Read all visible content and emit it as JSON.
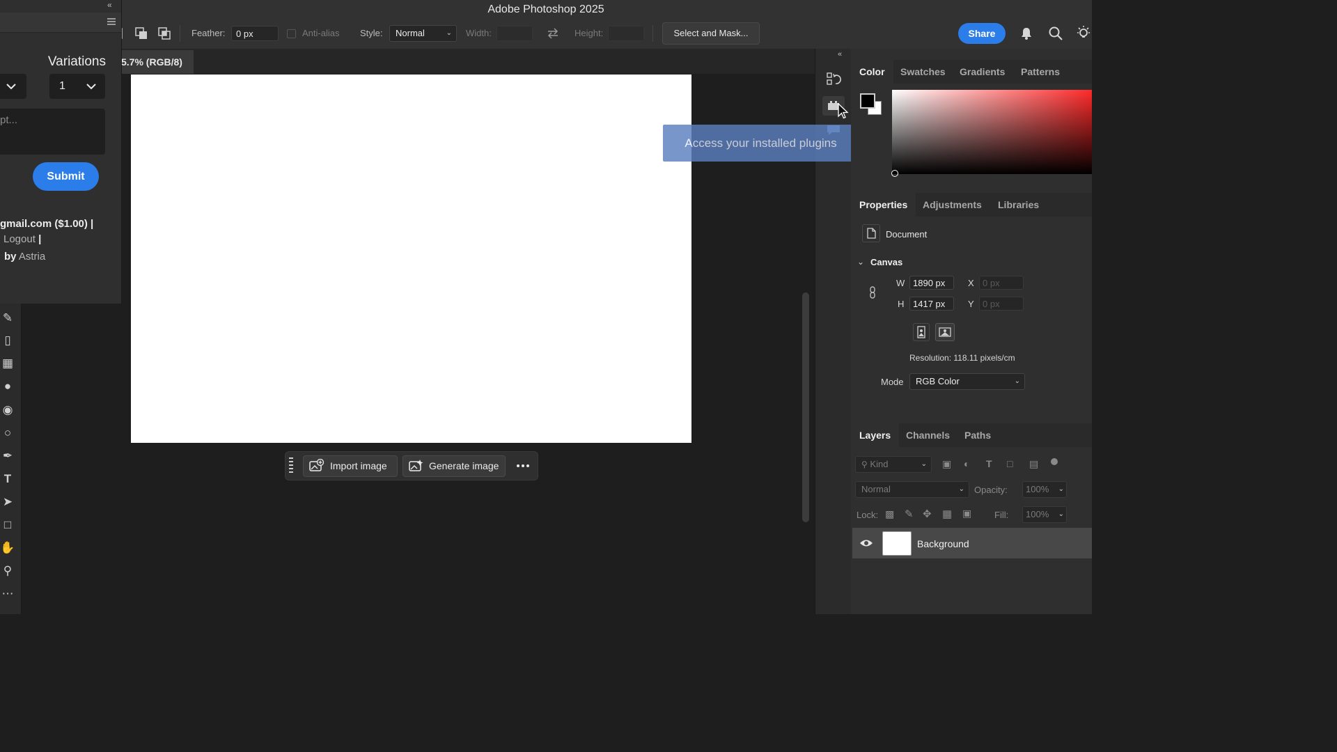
{
  "app": {
    "title": "Adobe Photoshop 2025"
  },
  "options_bar": {
    "feather_label": "Feather:",
    "feather_value": "0 px",
    "antialias_label": "Anti-alias",
    "style_label": "Style:",
    "style_value": "Normal",
    "width_label": "Width:",
    "height_label": "Height:",
    "select_mask_label": "Select and Mask...",
    "share_label": "Share"
  },
  "plugin_panel": {
    "variations_label": "Variations",
    "variations_value": "1",
    "prompt_placeholder": "pt...",
    "submit_label": "Submit",
    "account_text": "gmail.com ($1.00) |",
    "logout_label": "Logout",
    "logout_sep": "|",
    "by_label": "by",
    "by_link": "Astria"
  },
  "document": {
    "tab_label": "5.7% (RGB/8)"
  },
  "contextual_taskbar": {
    "import_label": "Import image",
    "generate_label": "Generate image"
  },
  "tooltip": {
    "text": "Access your installed plugins"
  },
  "color_panel": {
    "tabs": [
      "Color",
      "Swatches",
      "Gradients",
      "Patterns"
    ],
    "foreground": "#000000",
    "background": "#ffffff"
  },
  "properties_panel": {
    "tabs": [
      "Properties",
      "Adjustments",
      "Libraries"
    ],
    "document_label": "Document",
    "canvas_label": "Canvas",
    "w_label": "W",
    "w_value": "1890 px",
    "h_label": "H",
    "h_value": "1417 px",
    "x_label": "X",
    "x_value": "0 px",
    "y_label": "Y",
    "y_value": "0 px",
    "resolution": "Resolution: 118.11 pixels/cm",
    "mode_label": "Mode",
    "mode_value": "RGB Color"
  },
  "layers_panel": {
    "tabs": [
      "Layers",
      "Channels",
      "Paths"
    ],
    "kind_placeholder": "Kind",
    "blend_mode": "Normal",
    "opacity_label": "Opacity:",
    "opacity_value": "100%",
    "lock_label": "Lock:",
    "fill_label": "Fill:",
    "fill_value": "100%",
    "layer_name": "Background"
  },
  "colors": {
    "accent": "#2b7de9",
    "tooltip": "#5b7fbf"
  }
}
